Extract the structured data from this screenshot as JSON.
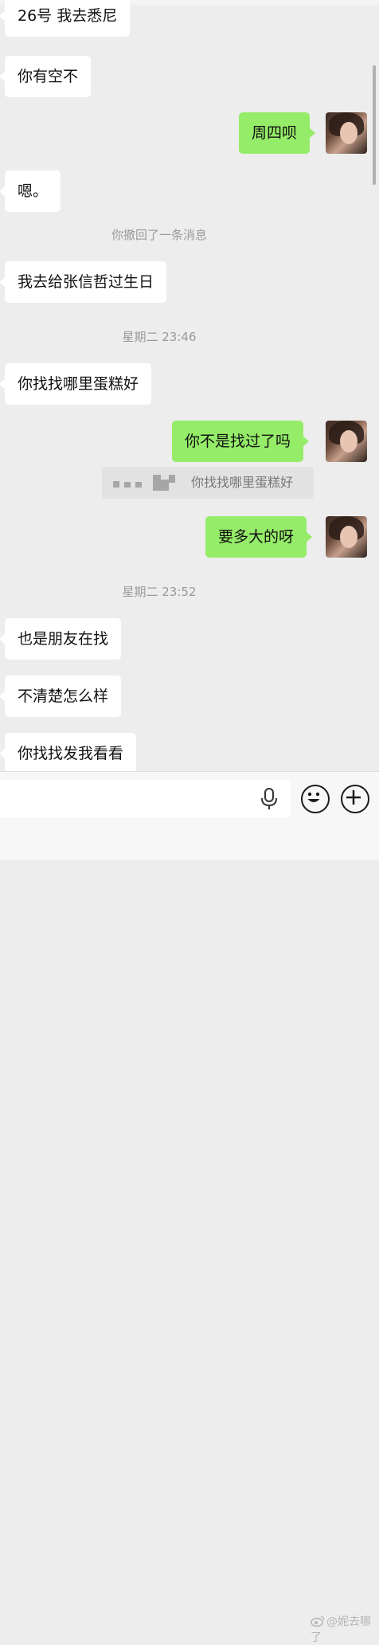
{
  "messages": [
    {
      "side": "in",
      "text": "26号 我去悉尼"
    },
    {
      "side": "in",
      "text": "你有空不"
    },
    {
      "side": "out",
      "text": "周四呗"
    },
    {
      "side": "in",
      "text": "嗯。"
    },
    {
      "side": "system",
      "text": "你撤回了一条消息"
    },
    {
      "side": "in",
      "text": "我去给张信哲过生日"
    },
    {
      "side": "system",
      "text": "星期二 23:46"
    },
    {
      "side": "in",
      "text": "你找找哪里蛋糕好"
    },
    {
      "side": "out",
      "text": "你不是找过了吗"
    },
    {
      "side": "quote",
      "text": "你找找哪里蛋糕好"
    },
    {
      "side": "out",
      "text": "要多大的呀"
    },
    {
      "side": "system",
      "text": "星期二 23:52"
    },
    {
      "side": "in",
      "text": "也是朋友在找"
    },
    {
      "side": "in",
      "text": "不清楚怎么样"
    },
    {
      "side": "in",
      "text": "你找找发我看看"
    }
  ],
  "input": {
    "value": "",
    "placeholder": ""
  },
  "icons": {
    "voice": "microphone-icon",
    "emoji": "smiley-icon",
    "more": "plus-icon"
  },
  "colors": {
    "background": "#ededed",
    "incoming": "#ffffff",
    "outgoing": "#95ec69",
    "system_text": "#9a9a9a"
  },
  "watermark": "@妮去哪了"
}
